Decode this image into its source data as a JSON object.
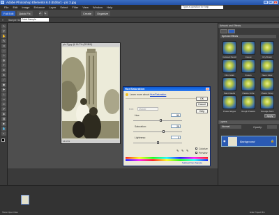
{
  "titlebar": {
    "title": "Adobe Photoshop Elements 6.0 (Editor) - pic 2.jpg"
  },
  "menu": {
    "items": [
      "File",
      "Edit",
      "Image",
      "Enhance",
      "Layer",
      "Select",
      "Filter",
      "View",
      "Window",
      "Help"
    ],
    "help_placeholder": "Type a question for help"
  },
  "toolbar": {
    "full_edit": "Full Edit",
    "quick_fix": "Quick Fix",
    "create": "Create",
    "organize": "Organize"
  },
  "options": {
    "sample_size_label": "Sample Size:",
    "sample_size_value": "Point Sample"
  },
  "document": {
    "title": "pic 2.jpg @ 16.7% (RGB/8)",
    "status": "16.67%"
  },
  "dialog": {
    "title": "Hue/Saturation",
    "learn_more": "Learn more about:",
    "learn_link": "Hue/Saturation",
    "edit_label": "Edit:",
    "edit_value": "Master",
    "hue_label": "Hue:",
    "hue_value": "50",
    "sat_label": "Saturation:",
    "sat_value": "25",
    "light_label": "Lightness:",
    "light_value": "0",
    "hue_pos": 0.57,
    "sat_pos": 0.62,
    "light_pos": 0.5,
    "ok": "OK",
    "cancel": "Cancel",
    "help": "Help",
    "colorize": "Colorize",
    "preview": "Preview",
    "colorize_checked": true,
    "preview_checked": true,
    "from_sample": "Subtract from Sample"
  },
  "panel": {
    "artwork_header": "Artwork and Effects",
    "effects_dropdown": "Special Effects",
    "effects": [
      "Colored Pencil",
      "Cutout",
      "Dry Brush",
      "Film Grain",
      "Fresco",
      "Neon Glow",
      "Paint Daubs",
      "Palette Knife",
      "Plastic Wrap",
      "Poster Edges",
      "Rough Pastels",
      "Smudge Stick"
    ],
    "apply": "Apply",
    "layers_header": "Layers",
    "blend_mode": "Normal",
    "opacity_label": "Opacity:",
    "layer_name": "Background"
  },
  "bottom": {
    "show_open": "Show Open Files",
    "hide": "Hide Project Bin"
  }
}
